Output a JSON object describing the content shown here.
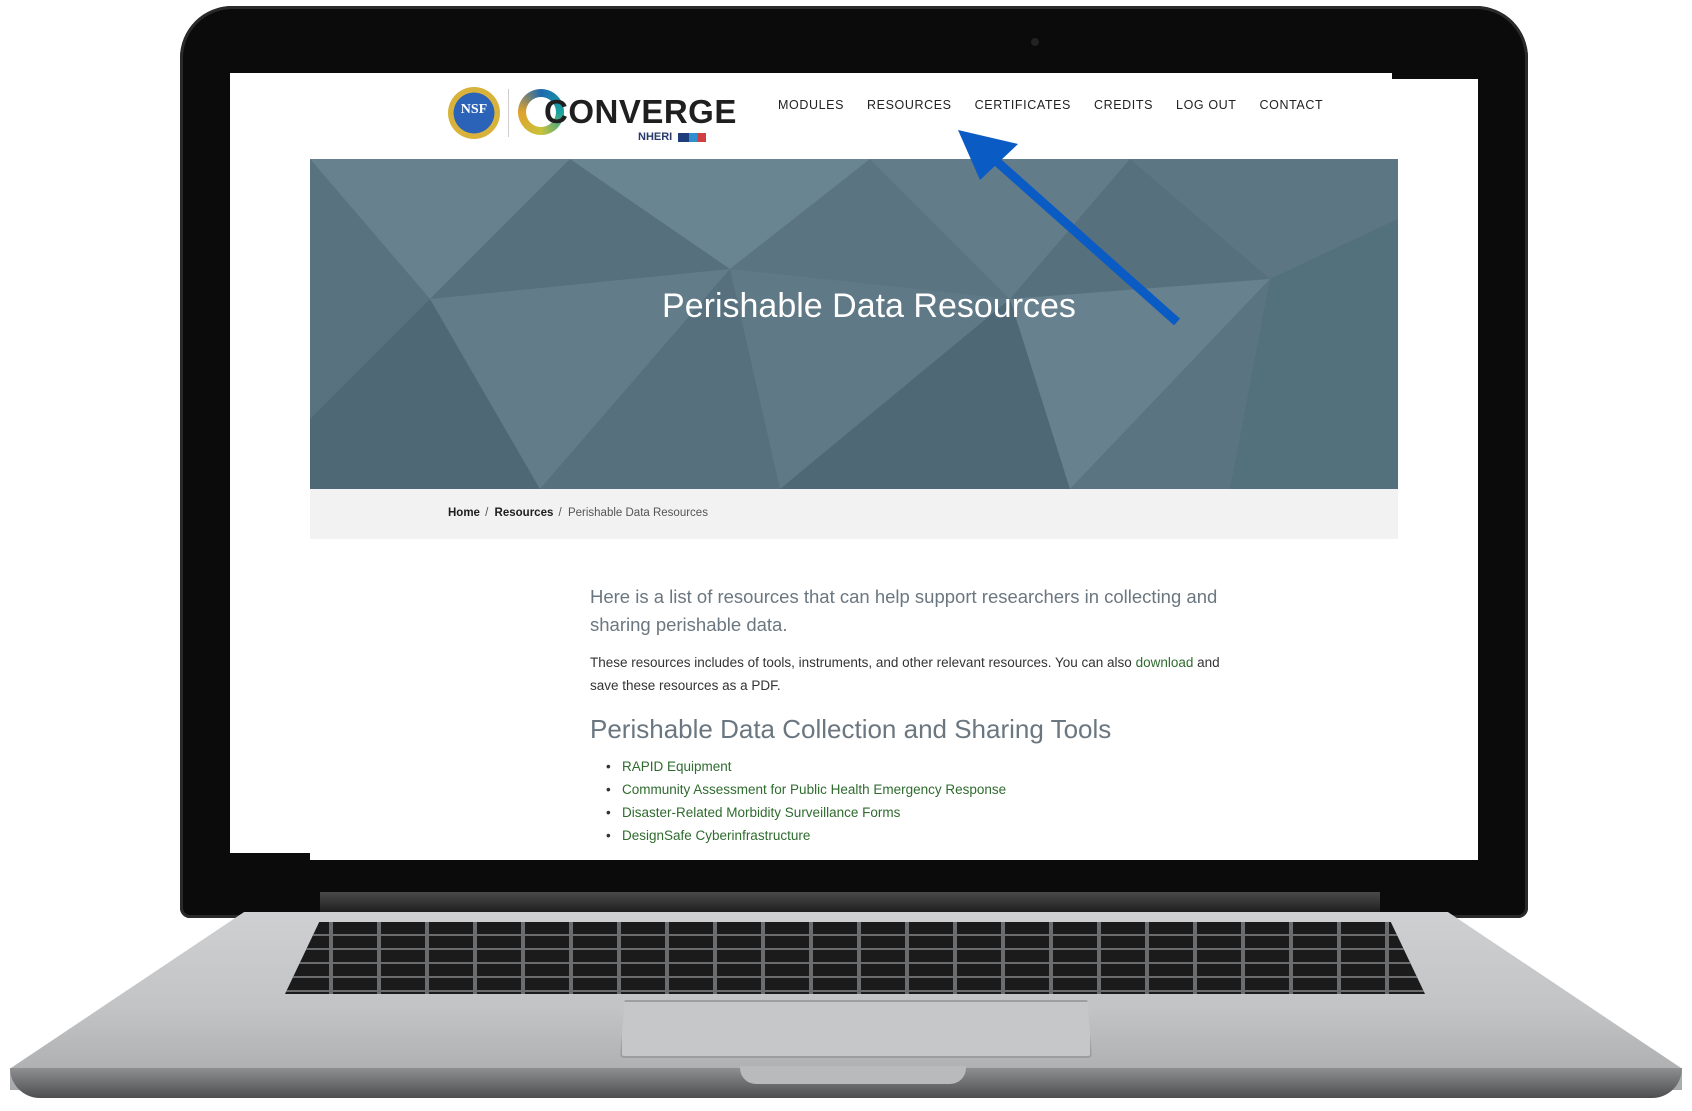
{
  "header": {
    "nsf_logo": {
      "text": "NSF",
      "icon": "nsf-seal"
    },
    "brand_logo": {
      "wordmark": "CONVERGE",
      "sub": "NHERI",
      "icon": "converge-logo"
    },
    "nav": [
      {
        "label": "MODULES"
      },
      {
        "label": "RESOURCES"
      },
      {
        "label": "CERTIFICATES"
      },
      {
        "label": "CREDITS"
      },
      {
        "label": "LOG OUT"
      },
      {
        "label": "CONTACT"
      }
    ]
  },
  "hero": {
    "title": "Perishable Data Resources"
  },
  "breadcrumb": {
    "items": [
      {
        "label": "Home"
      },
      {
        "label": "Resources"
      }
    ],
    "current": "Perishable Data Resources",
    "separator": "/"
  },
  "content": {
    "lead": "Here is a list of resources that can help support researchers in collecting and sharing perishable data.",
    "body_before": "These resources includes of tools, instruments, and other relevant resources. You can also ",
    "body_link": "download",
    "body_after": " and save these resources as a PDF.",
    "section_title": "Perishable Data Collection and Sharing Tools",
    "tools": [
      {
        "label": "RAPID Equipment"
      },
      {
        "label": "Community Assessment for Public Health Emergency Response"
      },
      {
        "label": "Disaster-Related Morbidity Surveillance Forms"
      },
      {
        "label": "DesignSafe Cyberinfrastructure"
      }
    ]
  },
  "annotation": {
    "icon": "pointer-arrow",
    "color": "#0a5bc4",
    "points_to": "RESOURCES"
  },
  "colors": {
    "hero_bg": "#5e7784",
    "link": "#2f6b2f",
    "heading_gray": "#6b7780"
  }
}
